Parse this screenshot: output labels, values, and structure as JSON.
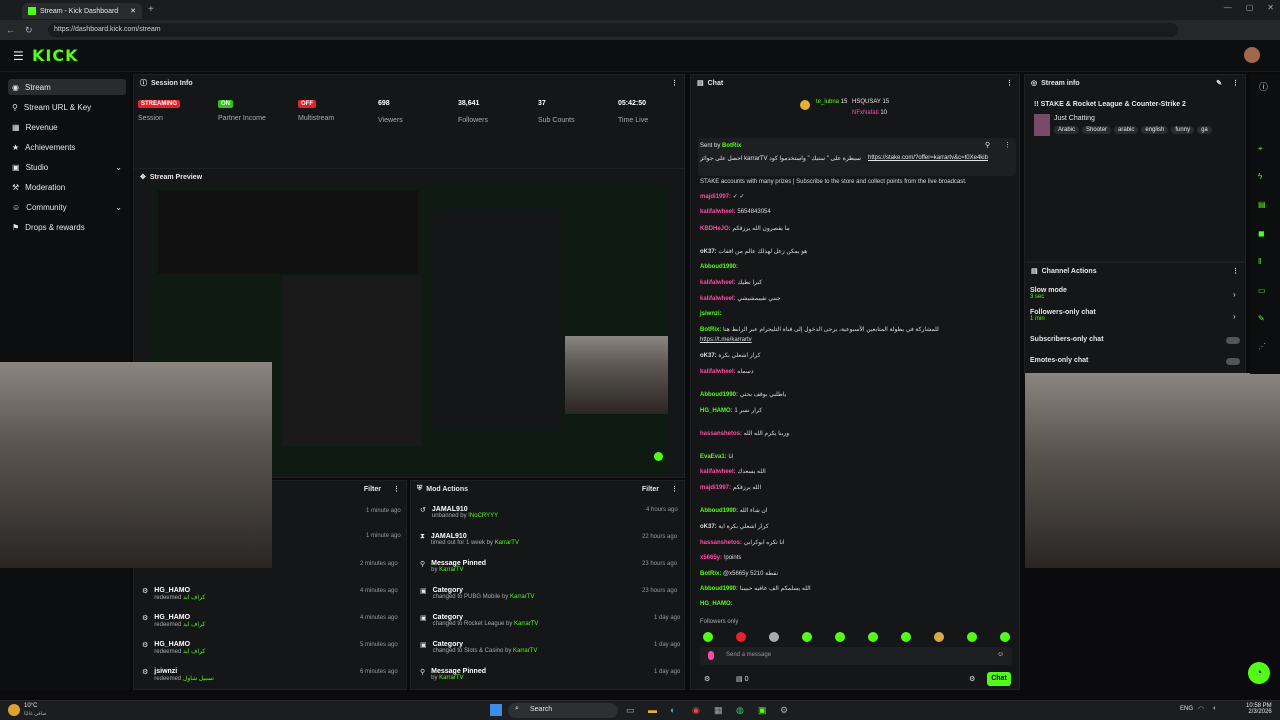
{
  "browser": {
    "tab_title": "Stream - Kick Dashboard",
    "url": "https://dashboard.kick.com/stream"
  },
  "app": {
    "logo": "KICK"
  },
  "sidebar": {
    "items": [
      {
        "label": "Stream",
        "active": true
      },
      {
        "label": "Stream URL & Key"
      },
      {
        "label": "Revenue"
      },
      {
        "label": "Achievements"
      },
      {
        "label": "Studio"
      },
      {
        "label": "Moderation"
      },
      {
        "label": "Community"
      },
      {
        "label": "Drops & rewards"
      }
    ]
  },
  "session": {
    "title": "Session Info",
    "streaming_badge": "STREAMING",
    "streaming_label": "Session",
    "partner_badge": "ON",
    "partner_label": "Partner Income",
    "multi_badge": "OFF",
    "multi_label": "Multistream",
    "viewers": "698",
    "viewers_label": "Viewers",
    "followers": "38,641",
    "followers_label": "Followers",
    "subs": "37",
    "subs_label": "Sub Counts",
    "time": "05:42:50",
    "time_label": "Time Live"
  },
  "preview": {
    "title": "Stream Preview"
  },
  "activity": {
    "filter": "Filter",
    "items": [
      {
        "time": "1 minute ago"
      },
      {
        "time": "1 minute ago"
      },
      {
        "time": "2 minutes ago"
      },
      {
        "name": "HG_HAMO",
        "desc": "redeemed",
        "reward": "كراف ايد",
        "time": "4 minutes ago"
      },
      {
        "name": "HG_HAMO",
        "desc": "redeemed",
        "reward": "كراف ايد",
        "time": "4 minutes ago"
      },
      {
        "name": "HG_HAMO",
        "desc": "redeemed",
        "reward": "كراف ايد",
        "time": "5 minutes ago"
      },
      {
        "name": "jsiwnzi",
        "desc": "redeemed",
        "reward": "تسبيل شاول",
        "time": "6 minutes ago"
      }
    ]
  },
  "mod": {
    "title": "Mod Actions",
    "filter": "Filter",
    "items": [
      {
        "title": "JAMAL910",
        "desc": "unbanned by",
        "by": "!NoCRYYY",
        "time": "4 hours ago"
      },
      {
        "title": "JAMAL910",
        "desc": "timed out for 1 week by",
        "by": "KarrarTV",
        "time": "22 hours ago"
      },
      {
        "title": "Message Pinned",
        "desc": "by",
        "by": "KarrarTV",
        "time": "23 hours ago"
      },
      {
        "title": "Category",
        "desc": "changed to PUBG Mobile by",
        "by": "KarrarTV",
        "time": "23 hours ago"
      },
      {
        "title": "Category",
        "desc": "changed to Rocket League by",
        "by": "KarrarTV",
        "time": "1 day ago"
      },
      {
        "title": "Category",
        "desc": "changed to Slots & Casino by",
        "by": "KarrarTV",
        "time": "1 day ago"
      },
      {
        "title": "Message Pinned",
        "desc": "by",
        "by": "KarrarTV",
        "time": "1 day ago"
      }
    ]
  },
  "chat": {
    "title": "Chat",
    "top1": "te_lubna",
    "top1n": "15",
    "top2": "HSQUSAY",
    "top2n": "15",
    "top3": "NFxNafati",
    "top3n": "10",
    "pinned_by": "Sent by",
    "pinned_user": "BotRix",
    "pinned_text": "احصل على جوائز karrarTV سيطرة على \" ستيك \" واستخدموا كود",
    "pinned_link": "https://stake.com/?offer=karrartv&c=t0Xe4kib",
    "lines": [
      {
        "u": "",
        "t": "STAKE accounts with many prizes | Subscribe to the store and collect points from the live broadcast."
      },
      {
        "u": "majdi1997:",
        "t": "✓ ✓"
      },
      {
        "u": "kalifalwheel:",
        "t": "5654843054"
      },
      {
        "u": "KBDHeJO:",
        "t": "ما يقصرون الله يرزقكم"
      },
      {
        "u": "oK37:",
        "t": "هو يمكن زعل لهذلك عالم من اقفات"
      },
      {
        "u": "Abboud1990:",
        "t": ""
      },
      {
        "u": "kalifalwheel:",
        "t": "كبرا نطيك"
      },
      {
        "u": "kalifalwheel:",
        "t": "جبني تقييمشيشي"
      },
      {
        "u": "jsiwnzi:",
        "t": ""
      },
      {
        "u": "BotRix:",
        "t": "للمشاركة في بطولة المتابعين الأسبوعية، يرجى الدخول إلى قناة التليجرام عبر الرابط هنا"
      },
      {
        "u": "",
        "t": "https://t.me/karrartv"
      },
      {
        "u": "oK37:",
        "t": "كرار اشعلي بكرة"
      },
      {
        "u": "kalifalwheel:",
        "t": "دسماه"
      },
      {
        "u": "Abboud1990:",
        "t": "ياطلبي بوقف بحثي"
      },
      {
        "u": "HG_HAMO:",
        "t": "كرار نسر 1"
      },
      {
        "u": "hassanshetos:",
        "t": "وربنا يكرم الله الله"
      },
      {
        "u": "EvaEva1:",
        "t": "انا"
      },
      {
        "u": "kalifalwheel:",
        "t": "الله يسعدك"
      },
      {
        "u": "majdi1997:",
        "t": "الله يرزقكم"
      },
      {
        "u": "Abboud1990:",
        "t": "ان شاء الله"
      },
      {
        "u": "oK37:",
        "t": "كرار اشعلي بكرة اية"
      },
      {
        "u": "hassanshetos:",
        "t": "انا تكره ابوكرابي"
      },
      {
        "u": "x5665y:",
        "t": "!points"
      },
      {
        "u": "BotRix:",
        "t": "@x5665y 5210 نقطة"
      },
      {
        "u": "Abboud1990:",
        "t": "الله يسلمكم الف عافيه حبيبنا"
      },
      {
        "u": "HG_HAMO:",
        "t": ""
      }
    ],
    "followers_only": "Followers only",
    "placeholder": "Send a message",
    "send": "Chat",
    "count": "0"
  },
  "stream_info": {
    "title": "Stream info",
    "stream_title": "!! STAKE & Rocket League & Counter-Strike 2",
    "category": "Just Chatting",
    "tags": [
      "Arabic",
      "Shooter",
      "arabic",
      "english",
      "funny",
      "ga"
    ]
  },
  "channel_actions": {
    "title": "Channel Actions",
    "items": [
      {
        "label": "Slow mode",
        "sub": "3 sec"
      },
      {
        "label": "Followers-only chat",
        "sub": "1 min"
      },
      {
        "label": "Subscribers-only chat",
        "sub": ""
      },
      {
        "label": "Emotes-only chat",
        "sub": ""
      }
    ]
  },
  "taskbar": {
    "weather": "10°C",
    "weather_sub": "صافي غالبًا",
    "search": "Search",
    "lang": "ENG",
    "time": "10:58 PM",
    "date": "2/3/2026"
  },
  "colors": {
    "accent": "#53fc18",
    "red": "#ff2d2d",
    "bg": "#0b0b0d"
  }
}
